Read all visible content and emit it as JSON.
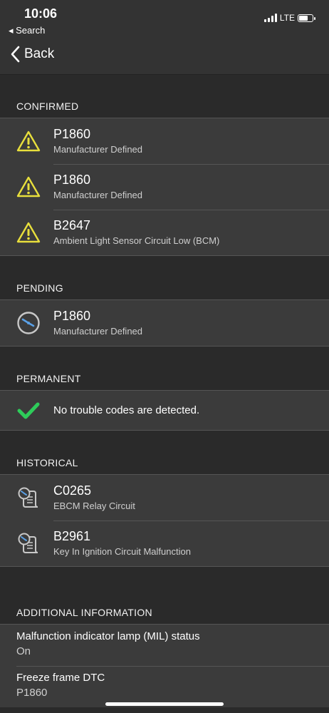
{
  "status": {
    "time": "10:06",
    "back_app": "◂ Search",
    "network": "LTE"
  },
  "nav": {
    "back_label": "Back"
  },
  "colors": {
    "warning": "#e8df3c",
    "check": "#2ecc5a",
    "clock": "#5aa0e6"
  },
  "sections": {
    "confirmed": {
      "title": "CONFIRMED",
      "items": [
        {
          "code": "P1860",
          "desc": "Manufacturer Defined",
          "icon": "warning-icon"
        },
        {
          "code": "P1860",
          "desc": "Manufacturer Defined",
          "icon": "warning-icon"
        },
        {
          "code": "B2647",
          "desc": "Ambient Light Sensor Circuit Low (BCM)",
          "icon": "warning-icon"
        }
      ]
    },
    "pending": {
      "title": "PENDING",
      "items": [
        {
          "code": "P1860",
          "desc": "Manufacturer Defined",
          "icon": "clock-icon"
        }
      ]
    },
    "permanent": {
      "title": "PERMANENT",
      "message": "No trouble codes are detected.",
      "icon": "checkmark-icon"
    },
    "historical": {
      "title": "HISTORICAL",
      "items": [
        {
          "code": "C0265",
          "desc": "EBCM Relay Circuit",
          "icon": "history-scroll-icon"
        },
        {
          "code": "B2961",
          "desc": "Key In Ignition Circuit Malfunction",
          "icon": "history-scroll-icon"
        }
      ]
    },
    "additional": {
      "title": "ADDITIONAL INFORMATION",
      "items": [
        {
          "label": "Malfunction indicator lamp (MIL) status",
          "value": "On"
        },
        {
          "label": "Freeze frame DTC",
          "value": "P1860"
        }
      ]
    }
  }
}
